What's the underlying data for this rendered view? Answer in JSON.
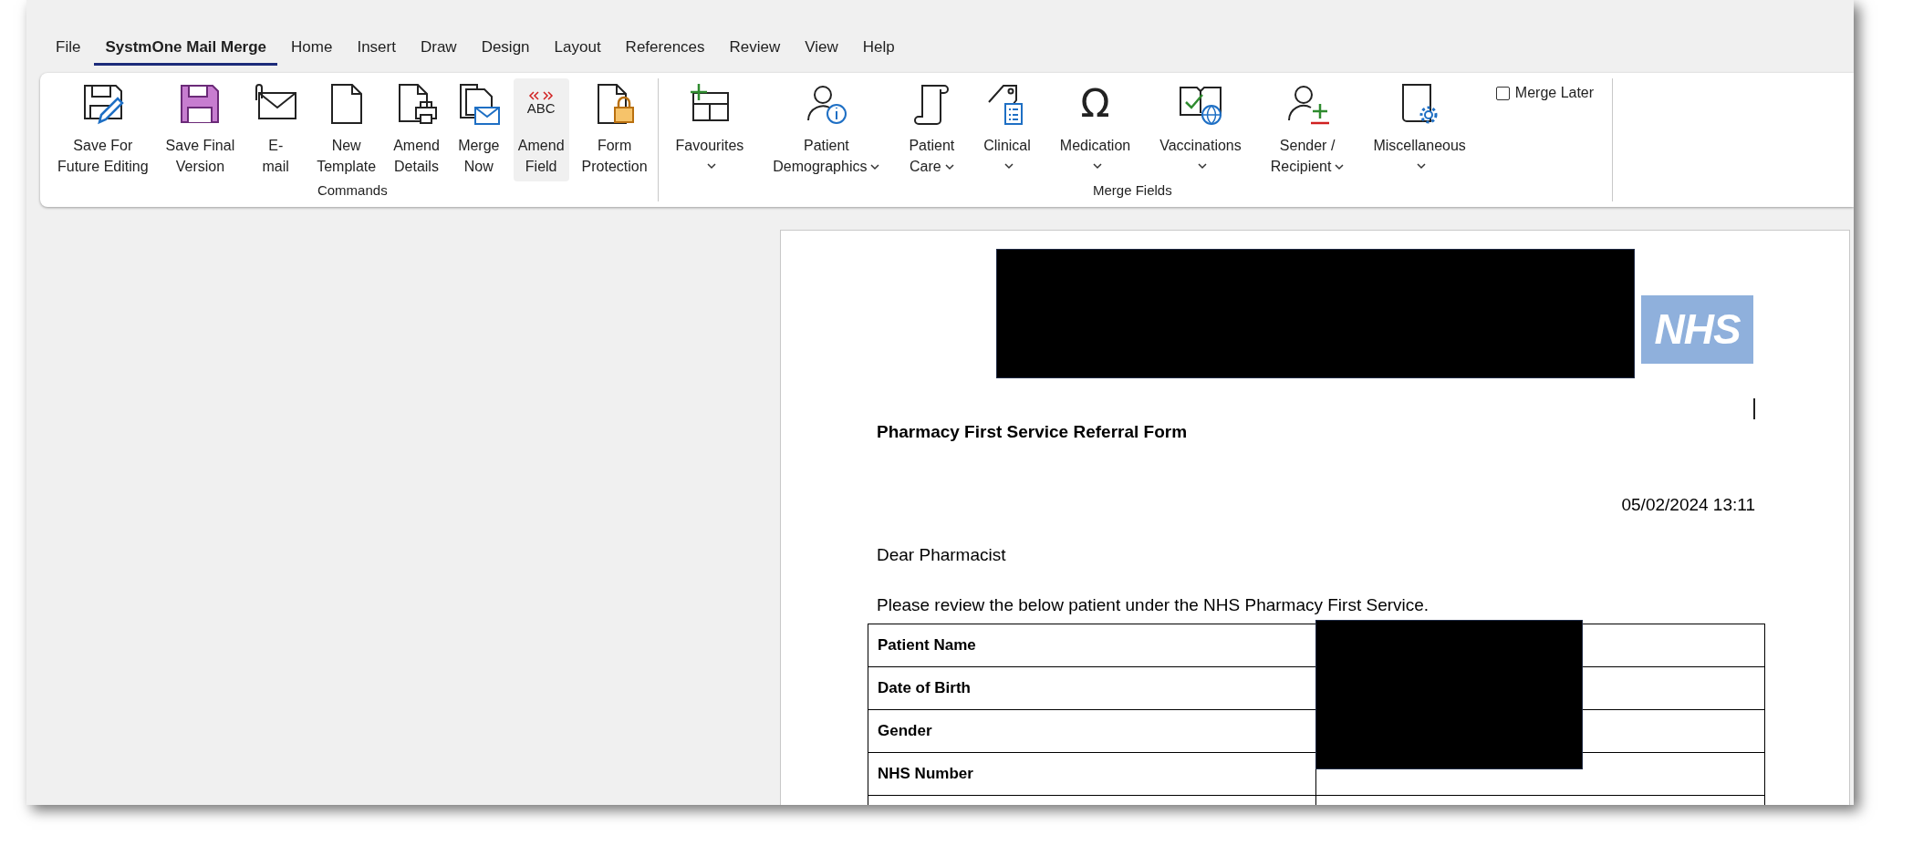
{
  "tabs": [
    {
      "label": "File",
      "selected": false
    },
    {
      "label": "SystmOne Mail Merge",
      "selected": true
    },
    {
      "label": "Home",
      "selected": false
    },
    {
      "label": "Insert",
      "selected": false
    },
    {
      "label": "Draw",
      "selected": false
    },
    {
      "label": "Design",
      "selected": false
    },
    {
      "label": "Layout",
      "selected": false
    },
    {
      "label": "References",
      "selected": false
    },
    {
      "label": "Review",
      "selected": false
    },
    {
      "label": "View",
      "selected": false
    },
    {
      "label": "Help",
      "selected": false
    }
  ],
  "ribbon": {
    "groups": [
      {
        "label": "Commands",
        "buttons": [
          {
            "lines": [
              "Save For",
              "Future Editing"
            ],
            "hovered": false
          },
          {
            "lines": [
              "Save Final",
              "Version"
            ],
            "hovered": false
          },
          {
            "lines": [
              "E-",
              "mail"
            ],
            "hovered": false
          },
          {
            "lines": [
              "New",
              "Template"
            ],
            "hovered": false
          },
          {
            "lines": [
              "Amend",
              "Details"
            ],
            "hovered": false
          },
          {
            "lines": [
              "Merge",
              "Now"
            ],
            "hovered": false
          },
          {
            "lines": [
              "Amend",
              "Field"
            ],
            "hovered": true,
            "icon_text": "ABC"
          },
          {
            "lines": [
              "Form",
              "Protection"
            ],
            "hovered": false
          }
        ]
      },
      {
        "label": "Merge Fields",
        "buttons": [
          {
            "lines": [
              "Favourites"
            ],
            "dropdown": true,
            "hovered": false
          },
          {
            "lines": [
              "Patient",
              "Demographics"
            ],
            "dropdown": true,
            "hovered": false
          },
          {
            "lines": [
              "Patient",
              "Care"
            ],
            "dropdown": true,
            "hovered": false
          },
          {
            "lines": [
              "Clinical"
            ],
            "dropdown": true,
            "hovered": false
          },
          {
            "lines": [
              "Medication"
            ],
            "dropdown": true,
            "hovered": false,
            "icon_glyph": "Ω"
          },
          {
            "lines": [
              "Vaccinations"
            ],
            "dropdown": true,
            "hovered": false
          },
          {
            "lines": [
              "Sender /",
              "Recipient"
            ],
            "dropdown": true,
            "hovered": false
          },
          {
            "lines": [
              "Miscellaneous"
            ],
            "dropdown": true,
            "hovered": false
          }
        ]
      }
    ],
    "merge_later": {
      "label": "Merge Later",
      "checked": false
    }
  },
  "document": {
    "logo": "NHS",
    "title": "Pharmacy First Service Referral Form",
    "date": "05/02/2024 13:11",
    "greeting": "Dear Pharmacist",
    "intro": "Please review the below patient under the NHS Pharmacy First Service.",
    "table": {
      "rows": [
        {
          "label": "Patient Name"
        },
        {
          "label": "Date of Birth"
        },
        {
          "label": "Gender"
        },
        {
          "label": "NHS Number"
        }
      ]
    }
  }
}
